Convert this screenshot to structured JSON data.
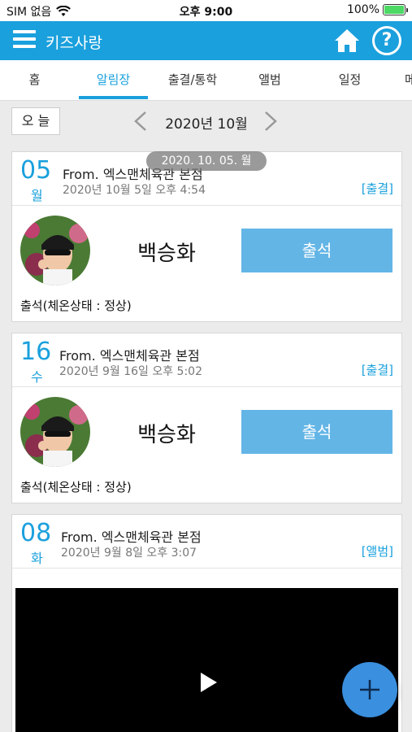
{
  "status_bar": {
    "carrier": "SIM 없음",
    "time": "오후 9:00",
    "battery": "100%"
  },
  "app_bar": {
    "title": "키즈사랑"
  },
  "tabs": [
    {
      "label": "홈"
    },
    {
      "label": "알림장"
    },
    {
      "label": "출결/통학"
    },
    {
      "label": "앨범"
    },
    {
      "label": "일정"
    },
    {
      "label": "메"
    }
  ],
  "active_tab": "알림장",
  "date_nav": {
    "today_label": "오 늘",
    "month_label": "2020년 10월"
  },
  "date_overlay": "2020. 10. 05. 월",
  "posts": [
    {
      "day": "05",
      "weekday": "월",
      "from": "From. 엑스맨체육관 본점",
      "datetime": "2020년 10월 5일 오후 4:54",
      "category": "[출결]",
      "child_name": "백승화",
      "button_label": "출석",
      "status": "출석(체온상태 : 정상)"
    },
    {
      "day": "16",
      "weekday": "수",
      "from": "From. 엑스맨체육관 본점",
      "datetime": "2020년 9월 16일 오후 5:02",
      "category": "[출결]",
      "child_name": "백승화",
      "button_label": "출석",
      "status": "출석(체온상태 : 정상)"
    },
    {
      "day": "08",
      "weekday": "화",
      "from": "From. 엑스맨체육관 본점",
      "datetime": "2020년 9월 8일 오후 3:07",
      "category": "[앨범]"
    }
  ],
  "icons": {
    "menu": "hamburger-menu-icon",
    "home": "home-icon",
    "help": "help-icon",
    "prev": "chevron-left-icon",
    "next": "chevron-right-icon",
    "play": "play-icon",
    "add": "plus-icon"
  },
  "colors": {
    "primary": "#1aa0dd",
    "attend_button": "#63b5e6",
    "fab": "#3a8fde"
  }
}
